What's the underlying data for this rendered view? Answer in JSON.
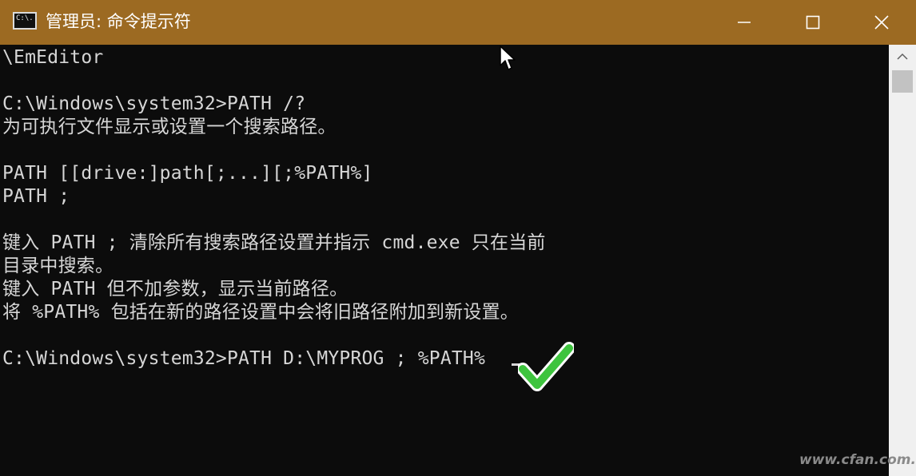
{
  "window": {
    "title": "管理员: 命令提示符",
    "app_icon_text": "C:\\.",
    "controls": {
      "minimize": "—",
      "maximize": "☐",
      "close": "✕"
    },
    "accent_color": "#9c6a22",
    "background_color": "#0c0c0c",
    "text_color": "#d6d6d6"
  },
  "console": {
    "lines": [
      "\\EmEditor",
      "",
      "C:\\Windows\\system32>PATH /?",
      "为可执行文件显示或设置一个搜索路径。",
      "",
      "PATH [[drive:]path[;...][;%PATH%]",
      "PATH ;",
      "",
      "键入 PATH ; 清除所有搜索路径设置并指示 cmd.exe 只在当前",
      "目录中搜索。",
      "键入 PATH 但不加参数，显示当前路径。",
      "将 %PATH% 包括在新的路径设置中会将旧路径附加到新设置。",
      "",
      "C:\\Windows\\system32>PATH D:\\MYPROG ; %PATH%"
    ]
  },
  "annotation": {
    "checkmark_icon": "green-checkmark-icon",
    "checkmark_color": "#3ec43e"
  },
  "watermark": {
    "text": "www.cfan.com.cn"
  }
}
